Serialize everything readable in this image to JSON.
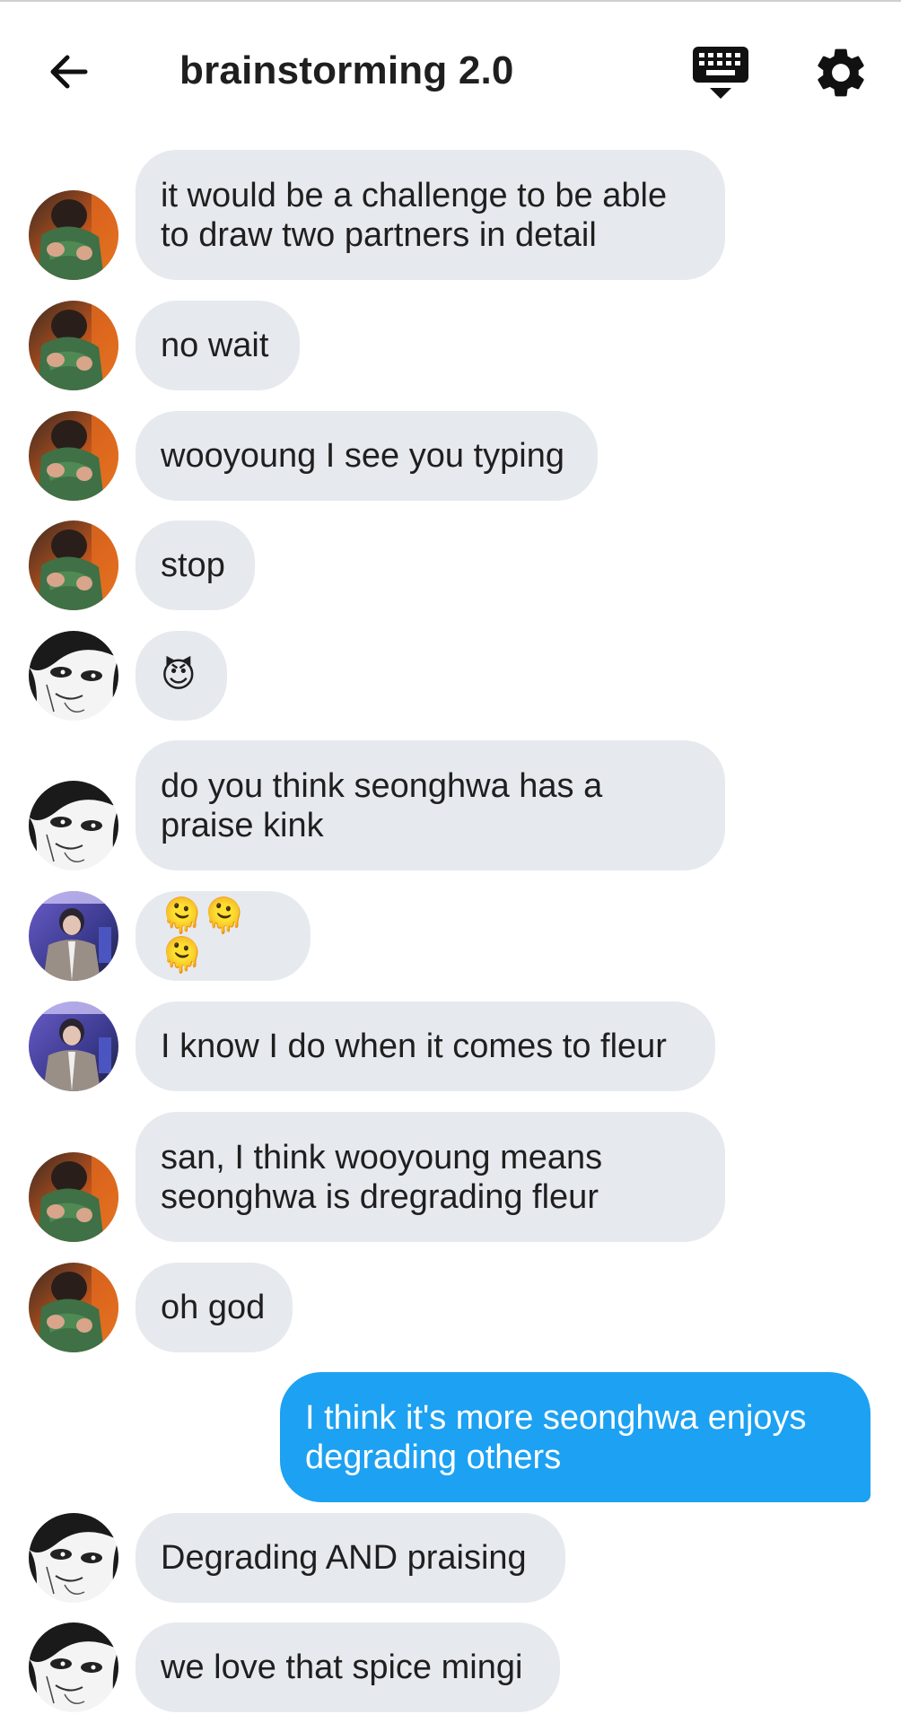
{
  "header": {
    "title": "brainstorming 2.0",
    "back_icon": "arrow-left-icon",
    "keyboard_icon": "keyboard-hide-icon",
    "settings_icon": "gear-icon"
  },
  "colors": {
    "incoming_bubble": "#e6e9ee",
    "outgoing_bubble": "#1da1f2"
  },
  "messages": [
    {
      "sender": "user-green",
      "text": "it would be a challenge to be able to draw two partners in detail"
    },
    {
      "sender": "user-green",
      "text": "no wait"
    },
    {
      "sender": "user-green",
      "text": "wooyoung I see you typing"
    },
    {
      "sender": "user-green",
      "text": "stop"
    },
    {
      "sender": "user-manga",
      "text": "😈"
    },
    {
      "sender": "user-manga",
      "text": "do you think seonghwa has a praise kink"
    },
    {
      "sender": "user-purple",
      "text": "🫠🫠🫠"
    },
    {
      "sender": "user-purple",
      "text": "I know I do when it comes to fleur"
    },
    {
      "sender": "user-green",
      "text": "san, I think wooyoung means seonghwa is dregrading fleur"
    },
    {
      "sender": "user-green",
      "text": "oh god"
    },
    {
      "sender": "me",
      "text": "I think it's more seonghwa enjoys degrading others"
    },
    {
      "sender": "user-manga",
      "text": "Degrading AND praising"
    },
    {
      "sender": "user-manga",
      "text": "we love that spice mingi"
    }
  ]
}
